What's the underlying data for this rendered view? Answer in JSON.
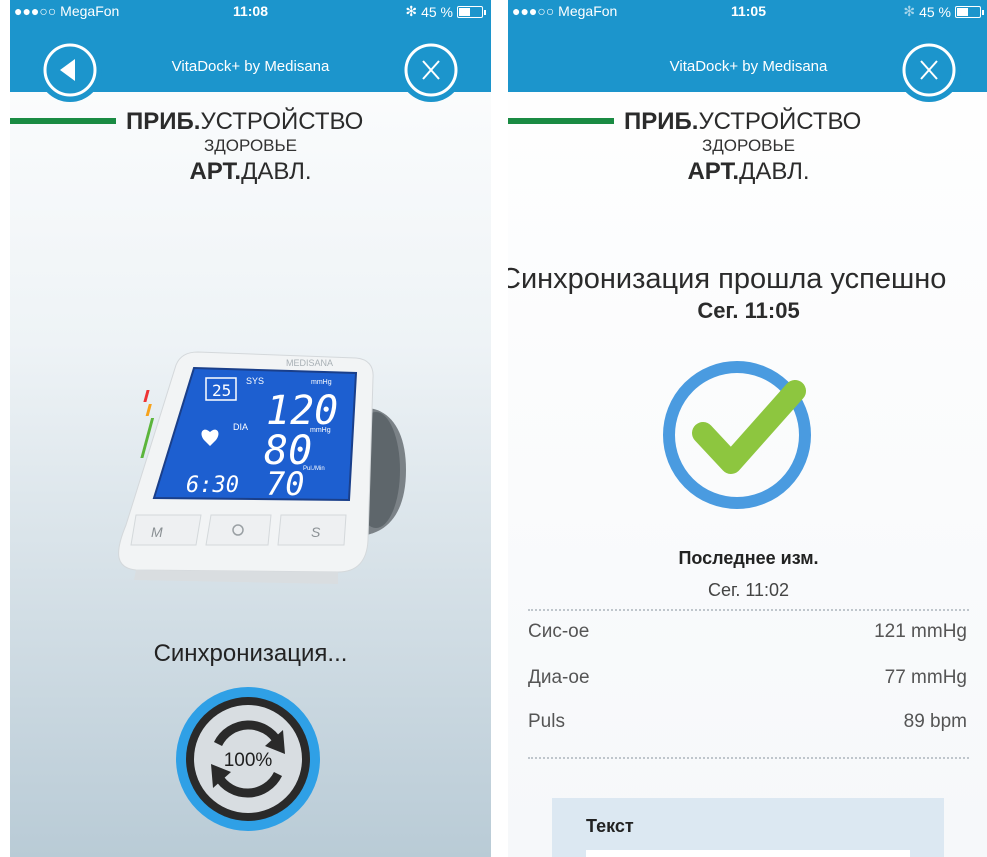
{
  "left": {
    "status": {
      "carrier": "●●●○○ MegaFon",
      "time": "11:08",
      "battery": "45 %",
      "battery_level": 0.45
    },
    "nav": {
      "title": "VitaDock+ by Medisana",
      "back_icon": "back-arrow-icon",
      "close_icon": "close-icon"
    },
    "heading": {
      "line1_bold": "ПРИБ.",
      "line1_rest": "УСТРОЙСТВО",
      "line2": "ЗДОРОВЬЕ",
      "line3_bold": "АРТ.",
      "line3_rest": "ДАВЛ."
    },
    "device": {
      "sys": "120",
      "dia": "80",
      "pulse": "70",
      "time": "6:30",
      "mem": "25",
      "unit": "mmHg",
      "sys_label": "SYS",
      "dia_label": "DIA",
      "pul_label": "Pul./Min",
      "brand": "MEDISANA",
      "btn_m": "M",
      "btn_s": "S"
    },
    "sync_label": "Синхронизация...",
    "progress": "100%",
    "progress_value": 1.0
  },
  "right": {
    "status": {
      "carrier": "●●●○○ MegaFon",
      "time": "11:05",
      "battery": "45 %",
      "battery_level": 0.45
    },
    "nav": {
      "title": "VitaDock+ by Medisana",
      "close_icon": "close-icon"
    },
    "heading": {
      "line1_bold": "ПРИБ.",
      "line1_rest": "УСТРОЙСТВО",
      "line2": "ЗДОРОВЬЕ",
      "line3_bold": "АРТ.",
      "line3_rest": "ДАВЛ."
    },
    "sync_success": "Синхронизация прошла успешно",
    "sync_time": "Сег. 11:05",
    "last_title": "Последнее изм.",
    "last_time": "Сег. 11:02",
    "measurements": [
      {
        "label": "Сис-ое",
        "value": "121 mmHg"
      },
      {
        "label": "Диа-ое",
        "value": "77 mmHg"
      },
      {
        "label": "Puls",
        "value": "89 bpm"
      }
    ],
    "text_label": "Текст"
  },
  "colors": {
    "brand_blue": "#1c95cc",
    "ring_blue": "#4a9be0",
    "check_green": "#8dc63f",
    "accent_green": "#1a8b43"
  }
}
